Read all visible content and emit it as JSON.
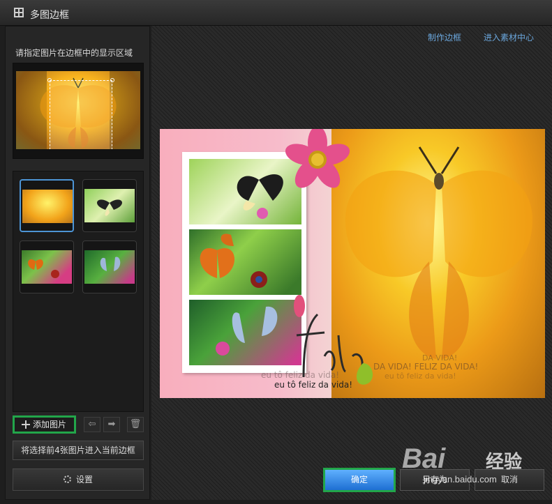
{
  "window": {
    "title": "多图边框",
    "top_links": [
      "制作边框",
      "进入素材中心"
    ]
  },
  "left": {
    "instruction": "请指定图片在边框中的显示区域",
    "add_button": "添加图片",
    "apply_button": "将选择前4张图片进入当前边框",
    "settings_button": "设置",
    "nav_icons": [
      "arrow-left-icon",
      "arrow-right-icon",
      "trash-icon"
    ]
  },
  "collage": {
    "caption_main": "eu tô feliz da vida!",
    "caption_ghost": "eu tô feliz da vida!",
    "script_word": "Feliz",
    "right_text_1": "DA VIDA!",
    "right_text_2": "DA VIDA! FELIZ DA VIDA!",
    "right_text_3": "eu tô feliz da vida!"
  },
  "footer": {
    "ok": "确定",
    "saveas": "另存为",
    "cancel": "取消"
  },
  "watermark": {
    "logo": "Bai",
    "jingyan": "经验",
    "url": "jingyan.baidu.com"
  },
  "colors": {
    "accent_blue": "#4d95d6",
    "highlight_green": "#22a64a",
    "link": "#6aa6dc"
  }
}
